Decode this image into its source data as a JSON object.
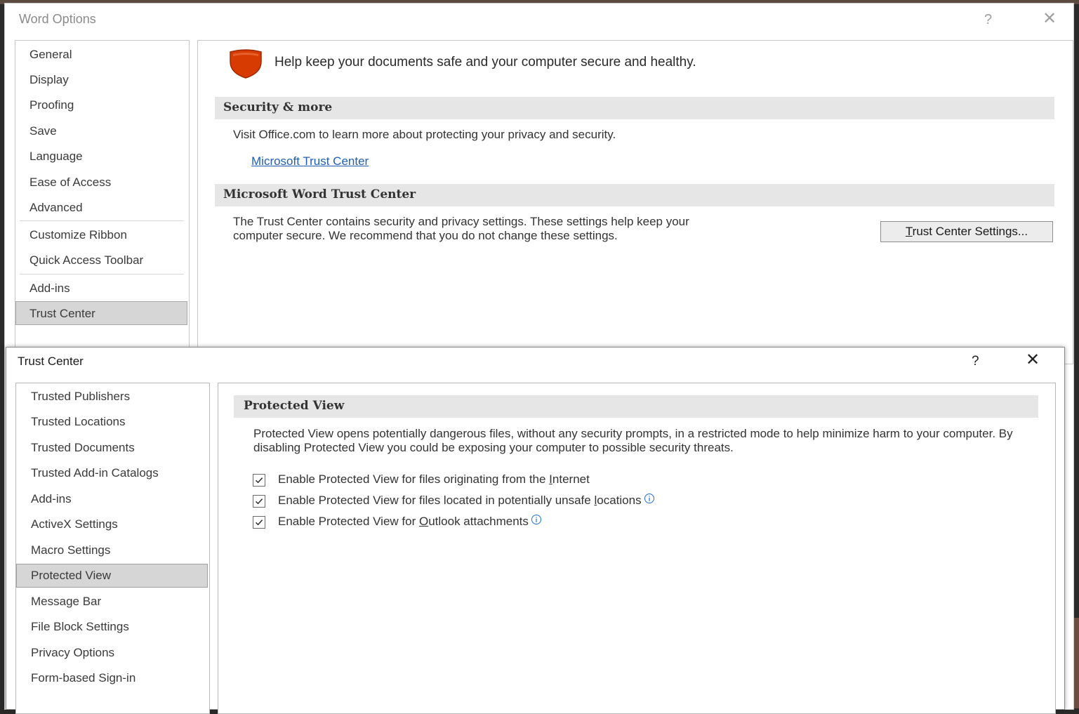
{
  "word_options": {
    "title": "Word Options",
    "help": "?",
    "close": "✕",
    "nav": [
      "General",
      "Display",
      "Proofing",
      "Save",
      "Language",
      "Ease of Access",
      "Advanced",
      "Customize Ribbon",
      "Quick Access Toolbar",
      "Add-ins",
      "Trust Center"
    ],
    "selected_nav": "Trust Center",
    "headline": "Help keep your documents safe and your computer secure and healthy.",
    "security_section": {
      "title": "Security & more",
      "text": "Visit Office.com to learn more about protecting your privacy and security.",
      "link": "Microsoft Trust Center"
    },
    "trust_center_section": {
      "title": "Microsoft Word Trust Center",
      "text_line1": "The Trust Center contains security and privacy settings. These settings help keep your",
      "text_line2": "computer secure. We recommend that you do not change these settings.",
      "button_label": "Trust Center Settings..."
    },
    "colors": {
      "shield": "#d83b01",
      "link": "#1e5fb5"
    }
  },
  "trust_center": {
    "title": "Trust Center",
    "help": "?",
    "close": "✕",
    "nav": [
      "Trusted Publishers",
      "Trusted Locations",
      "Trusted Documents",
      "Trusted Add-in Catalogs",
      "Add-ins",
      "ActiveX Settings",
      "Macro Settings",
      "Protected View",
      "Message Bar",
      "File Block Settings",
      "Privacy Options",
      "Form-based Sign-in"
    ],
    "selected_nav": "Protected View",
    "section_title": "Protected View",
    "description": "Protected View opens potentially dangerous files, without any security prompts, in a restricted mode to help minimize harm to your computer. By disabling Protected View you could be exposing your computer to possible security threats.",
    "options": [
      {
        "label_before": "Enable Protected View for files originating from the ",
        "label_underline": "I",
        "label_after": "nternet",
        "checked": true,
        "info_icon": false
      },
      {
        "label_before": "Enable Protected View for files located in potentially unsafe ",
        "label_underline": "l",
        "label_after": "ocations",
        "checked": true,
        "info_icon": true
      },
      {
        "label_before": "Enable Protected View for ",
        "label_underline": "O",
        "label_after": "utlook attachments",
        "checked": true,
        "info_icon": true
      }
    ]
  }
}
